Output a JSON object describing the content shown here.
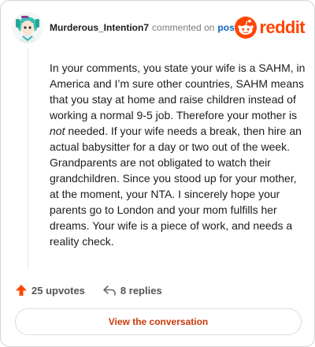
{
  "comment": {
    "author": "Murderous_Intention7",
    "action_text": "commented on",
    "post_link_label": "post",
    "body_before": "In your comments, you state your wife is a SAHM, in America and I’m sure other countries, SAHM means that you stay at home and raise children instead of working a normal 9-5 job. Therefore your mother is ",
    "body_emphasis": "not",
    "body_after": " needed. If your wife needs a break, then hire an actual babysitter for a day or two out of the week. Grandparents are not obligated to watch their grandchildren. Since you stood up for your mother, at the moment, your NTA. I sincerely hope your parents go to London and your mom fulfills her dreams. Your wife is a piece of work, and needs a reality check."
  },
  "brand": {
    "wordmark": "reddit",
    "icon": "reddit-snoo-icon",
    "color": "#ff4500"
  },
  "footer": {
    "upvotes_label": "25 upvotes",
    "upvote_icon": "upvote-arrow-icon",
    "replies_label": "8 replies",
    "reply_icon": "reply-arrow-icon",
    "cta_label": "View the conversation"
  },
  "colors": {
    "upvote": "#ff4500",
    "link": "#0a66c2",
    "cta_text": "#c63b0c"
  }
}
